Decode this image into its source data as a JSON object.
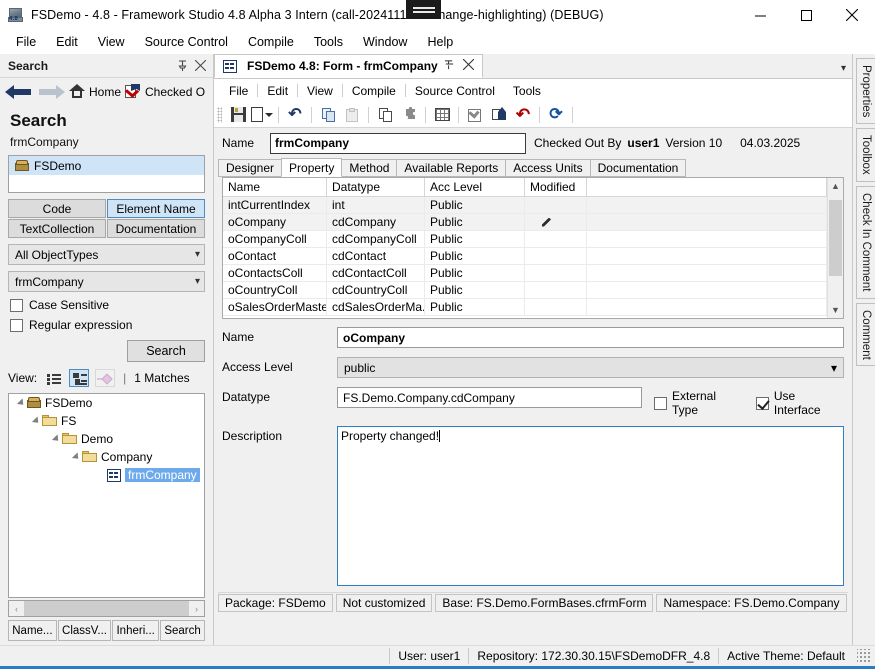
{
  "window": {
    "title": "FSDemo - 4.8 - Framework Studio 4.8 Alpha 3 Intern (call-2024111470-change-highlighting) (DEBUG)",
    "icon": "app-icon",
    "icon_version": "4.8",
    "minimize": "minimize-icon",
    "maximize": "maximize-icon",
    "close": "close-icon"
  },
  "menubar": {
    "items": [
      {
        "label": "File"
      },
      {
        "label": "Edit"
      },
      {
        "label": "View"
      },
      {
        "label": "Source Control"
      },
      {
        "label": "Compile"
      },
      {
        "label": "Tools"
      },
      {
        "label": "Window"
      },
      {
        "label": "Help"
      }
    ]
  },
  "search_panel": {
    "header": {
      "title": "Search",
      "pin": "pin-icon",
      "close": "close-icon"
    },
    "nav": {
      "back": "arrow-back-icon",
      "forward": "arrow-forward-icon",
      "home_label": "Home",
      "home_icon": "home-icon",
      "checked_label": "Checked O",
      "checked_icon": "checked-out-icon"
    },
    "heading": "Search",
    "term": "frmCompany",
    "result": {
      "label": "FSDemo",
      "icon": "package-icon"
    },
    "scope_buttons": [
      {
        "label": "Code",
        "selected": false
      },
      {
        "label": "Element Name",
        "selected": true
      },
      {
        "label": "TextCollection",
        "selected": false
      },
      {
        "label": "Documentation",
        "selected": false
      }
    ],
    "objecttype_combo": {
      "value": "All ObjectTypes",
      "caret": "chevron-down-icon"
    },
    "term_combo": {
      "value": "frmCompany",
      "caret": "chevron-down-icon"
    },
    "checkboxes": [
      {
        "label": "Case Sensitive",
        "checked": false
      },
      {
        "label": "Regular expression",
        "checked": false
      }
    ],
    "search_button": "Search",
    "view": {
      "label": "View:",
      "icons": [
        {
          "name": "list-view-icon",
          "selected": false,
          "disabled": false
        },
        {
          "name": "tree-view-icon",
          "selected": true,
          "disabled": false
        },
        {
          "name": "diagram-view-icon",
          "selected": false,
          "disabled": true
        }
      ],
      "separator": "|",
      "matches": "1 Matches"
    },
    "tree": [
      {
        "label": "FSDemo",
        "indent": 0,
        "icon": "package-icon",
        "expanded": true,
        "selected": false
      },
      {
        "label": "FS",
        "indent": 1,
        "icon": "folder-icon",
        "expanded": true,
        "selected": false
      },
      {
        "label": "Demo",
        "indent": 2,
        "icon": "folder-icon",
        "expanded": true,
        "selected": false
      },
      {
        "label": "Company",
        "indent": 3,
        "icon": "folder-icon",
        "expanded": true,
        "selected": false
      },
      {
        "label": "frmCompany",
        "indent": 4,
        "icon": "form-icon",
        "expanded": false,
        "selected": true
      }
    ],
    "hscroll": {
      "left": "‹",
      "right": "›"
    },
    "bottom_tabs": [
      {
        "label": "Name...",
        "active": false
      },
      {
        "label": "ClassV...",
        "active": false
      },
      {
        "label": "Inheri...",
        "active": false
      },
      {
        "label": "Search",
        "active": true
      }
    ]
  },
  "document": {
    "tab": {
      "title": "FSDemo 4.8: Form - frmCompany",
      "icon": "form-icon",
      "pin": "pin-icon",
      "close": "close-icon"
    },
    "tabstrip_caret": "chevron-down-icon",
    "menu": [
      {
        "label": "File"
      },
      {
        "label": "Edit"
      },
      {
        "label": "View"
      },
      {
        "label": "Compile"
      },
      {
        "label": "Source Control"
      },
      {
        "label": "Tools"
      }
    ],
    "toolbar": [
      {
        "name": "save-icon"
      },
      {
        "name": "new-document-icon"
      },
      {
        "name": "undo-icon"
      },
      {
        "name": "copy-icon"
      },
      {
        "name": "paste-icon"
      },
      {
        "name": "duplicate-icon"
      },
      {
        "name": "plugin-icon"
      },
      {
        "name": "grid-icon"
      },
      {
        "name": "check-icon"
      },
      {
        "name": "check-in-icon"
      },
      {
        "name": "revert-icon"
      },
      {
        "name": "refresh-icon"
      }
    ],
    "name_field": {
      "label": "Name",
      "value": "frmCompany"
    },
    "checkout": {
      "checked_out_by_label": "Checked Out By",
      "user": "user1",
      "version_label": "Version 10",
      "date": "04.03.2025"
    },
    "tabs": [
      {
        "label": "Designer",
        "active": false
      },
      {
        "label": "Property",
        "active": true
      },
      {
        "label": "Method",
        "active": false
      },
      {
        "label": "Available Reports",
        "active": false
      },
      {
        "label": "Access Units",
        "active": false
      },
      {
        "label": "Documentation",
        "active": false
      }
    ],
    "grid": {
      "columns": [
        "Name",
        "Datatype",
        "Acc Level",
        "Modified",
        ""
      ],
      "rows": [
        {
          "cells": [
            "intCurrentIndex",
            "int",
            "Public",
            "",
            ""
          ],
          "modified": false
        },
        {
          "cells": [
            "oCompany",
            "cdCompany",
            "Public",
            "",
            ""
          ],
          "modified": true
        },
        {
          "cells": [
            "oCompanyColl",
            "cdCompanyColl",
            "Public",
            "",
            ""
          ],
          "modified": false
        },
        {
          "cells": [
            "oContact",
            "cdContact",
            "Public",
            "",
            ""
          ],
          "modified": false
        },
        {
          "cells": [
            "oContactsColl",
            "cdContactColl",
            "Public",
            "",
            ""
          ],
          "modified": false
        },
        {
          "cells": [
            "oCountryColl",
            "cdCountryColl",
            "Public",
            "",
            ""
          ],
          "modified": false
        },
        {
          "cells": [
            "oSalesOrderMaster",
            "cdSalesOrderMa...",
            "Public",
            "",
            ""
          ],
          "modified": false
        }
      ],
      "scroll_up": "scroll-up-icon",
      "scroll_down": "scroll-down-icon"
    },
    "detail": {
      "name": {
        "label": "Name",
        "value": "oCompany"
      },
      "access_level": {
        "label": "Access Level",
        "value": "public",
        "caret": "chevron-down-icon"
      },
      "datatype": {
        "label": "Datatype",
        "value": "FS.Demo.Company.cdCompany"
      },
      "external_type": {
        "label": "External Type",
        "checked": false
      },
      "use_interface": {
        "label": "Use Interface",
        "checked": true
      },
      "description": {
        "label": "Description",
        "value": "Property changed!"
      }
    },
    "status": [
      "Package: FSDemo",
      "Not customized",
      "Base: FS.Demo.FormBases.cfrmForm",
      "Namespace: FS.Demo.Company"
    ]
  },
  "right_tabs": [
    {
      "label": "Properties"
    },
    {
      "label": "Toolbox"
    },
    {
      "label": "Check In Comment"
    },
    {
      "label": "Comment"
    }
  ],
  "app_status": [
    "User: user1",
    "Repository: 172.30.30.15\\FSDemoDFR_4.8",
    "Active Theme: Default"
  ],
  "colors": {
    "accent": "#2b7cc4",
    "selection": "#6daaec",
    "tab_selected": "#cfe4f7",
    "chrome": "#f0f0f0"
  }
}
